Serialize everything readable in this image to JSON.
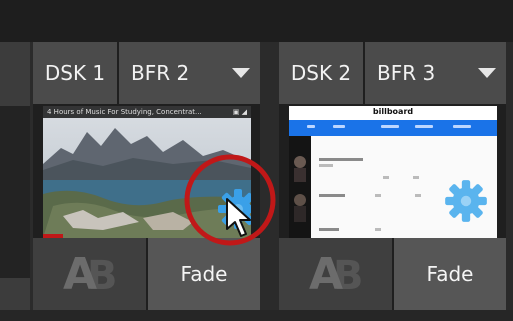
{
  "panels": [
    {
      "dsk_label": "DSK 1",
      "bfr_label": "BFR 2",
      "thumbnail": {
        "type": "video",
        "title": "4 Hours of Music For Studying, Concentrat..."
      },
      "ab_icon": "ab-transition-icon",
      "fade_label": "Fade"
    },
    {
      "dsk_label": "DSK 2",
      "bfr_label": "BFR 3",
      "thumbnail": {
        "type": "webpage",
        "logo": "billboard"
      },
      "ab_icon": "ab-transition-icon",
      "fade_label": "Fade"
    }
  ],
  "gear_icon_color": "#3aa0e8",
  "highlight_ring_color": "#c01818",
  "cursor_icon": "mouse-pointer-icon"
}
